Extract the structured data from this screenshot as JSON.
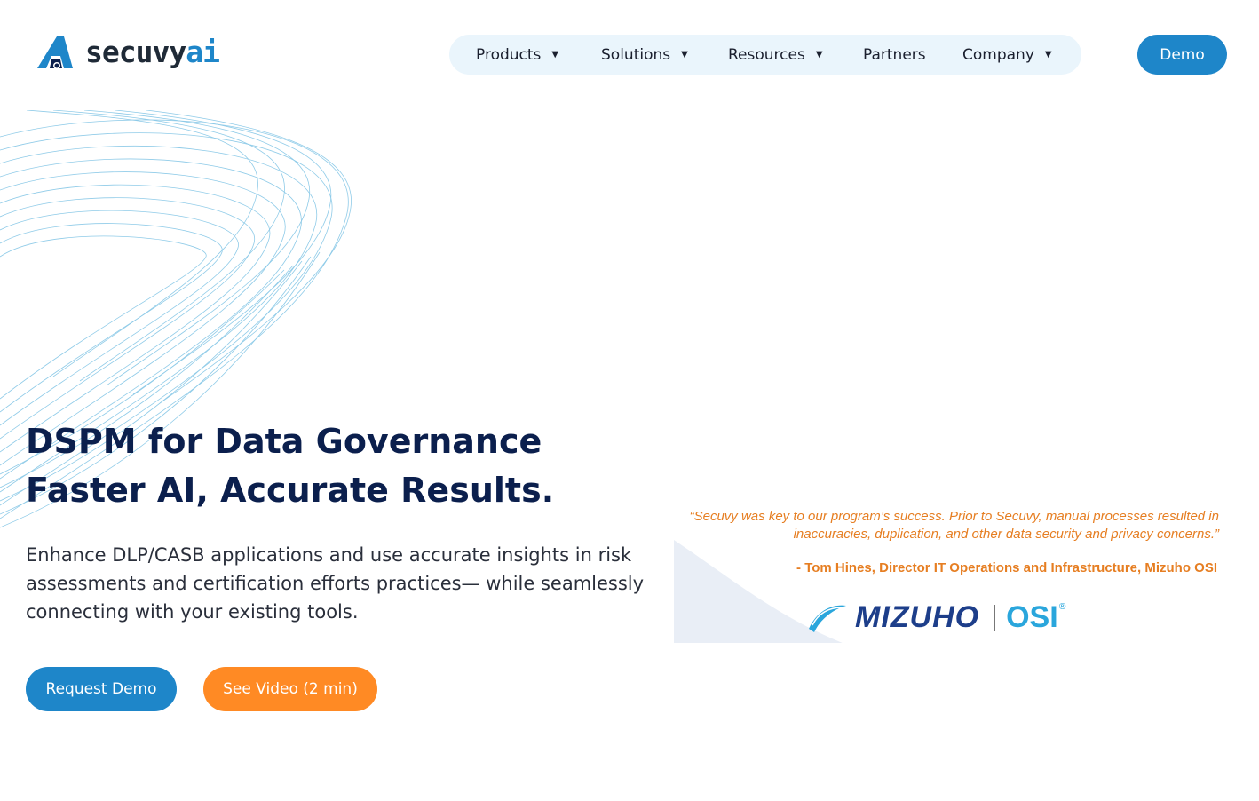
{
  "brand": {
    "name_part1": "secuvy",
    "name_part2": "ai",
    "colors": {
      "primary": "#1e86c9",
      "orange": "#ff8a24",
      "navy": "#0b1f4d",
      "nav_bg": "#eaf5fc"
    }
  },
  "nav": {
    "items": [
      {
        "label": "Products",
        "has_dropdown": true
      },
      {
        "label": "Solutions",
        "has_dropdown": true
      },
      {
        "label": "Resources",
        "has_dropdown": true
      },
      {
        "label": "Partners",
        "has_dropdown": false
      },
      {
        "label": "Company",
        "has_dropdown": true
      }
    ],
    "caret_glyph": "▼"
  },
  "header": {
    "demo_label": "Demo"
  },
  "hero": {
    "title_line1": "DSPM for Data Governance",
    "title_line2": "Faster AI, Accurate Results.",
    "subtitle": "Enhance DLP/CASB applications and use accurate insights in risk assessments and certification efforts practices— while seamlessly connecting with your existing tools.",
    "primary_cta": "Request Demo",
    "secondary_cta": "See Video (2 min)"
  },
  "testimonial": {
    "quote": "“Secuvy was key to our program’s success.  Prior to Secuvy, manual processes resulted in inaccuracies, duplication, and other data security and privacy concerns.”",
    "attribution": "- Tom Hines, Director IT Operations and Infrastructure, Mizuho OSI",
    "logo_left": "MIZUHO",
    "logo_right": "OSI",
    "logo_reg": "®"
  }
}
